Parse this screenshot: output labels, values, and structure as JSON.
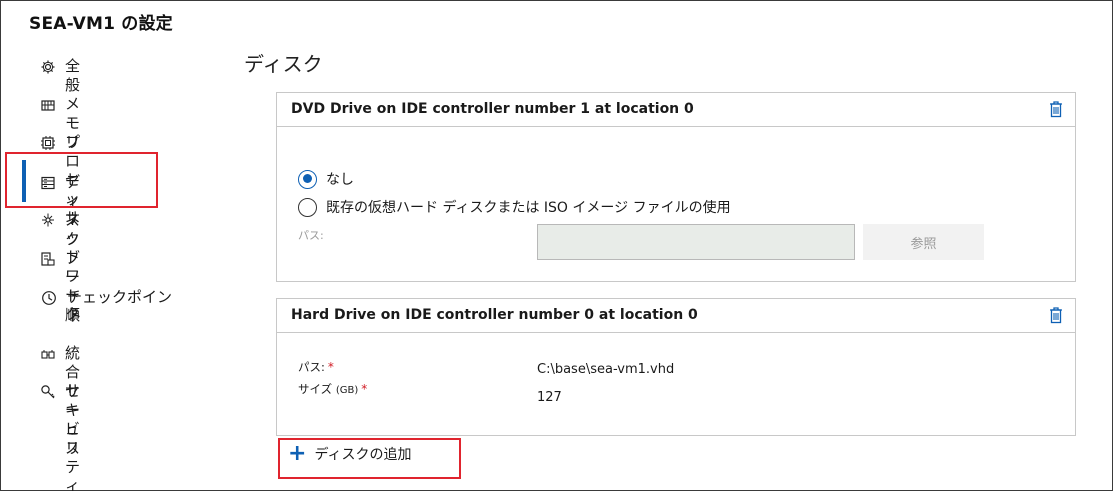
{
  "window": {
    "title": "SEA-VM1 の設定"
  },
  "sidebar": {
    "items": [
      {
        "label": "全般",
        "icon": "gear-icon"
      },
      {
        "label": "メモリ",
        "icon": "memory-icon"
      },
      {
        "label": "プロセッサ",
        "icon": "processor-icon"
      },
      {
        "label": "ディスク",
        "icon": "disk-icon",
        "active": true
      },
      {
        "label": "ネットワーク",
        "icon": "network-icon"
      },
      {
        "label": "ブート順",
        "icon": "boot-order-icon"
      },
      {
        "label": "チェックポイント",
        "icon": "clock-icon"
      },
      {
        "label": "統合サービス",
        "icon": "integration-icon"
      },
      {
        "label": "セキュリティ",
        "icon": "key-icon"
      }
    ],
    "accent_color": "#0e60b4"
  },
  "main": {
    "section_title": "ディスク",
    "dvd_panel": {
      "title": "DVD Drive on IDE controller number 1 at location 0",
      "option_none": "なし",
      "option_iso": "既存の仮想ハード ディスクまたは ISO イメージ ファイルの使用",
      "path_label": "パス:",
      "path_value": "",
      "browse_label": "参照"
    },
    "hd_panel": {
      "title": "Hard Drive on IDE controller number 0 at location 0",
      "path_label": "パス:",
      "size_label": "サイズ",
      "size_unit": "(GB)",
      "required_mark": "*",
      "path_value": "C:\\base\\sea-vm1.vhd",
      "size_value": "127"
    },
    "add_disk_label": "ディスクの追加"
  },
  "colors": {
    "highlight": "#e0242e",
    "accent": "#0e60b4"
  }
}
